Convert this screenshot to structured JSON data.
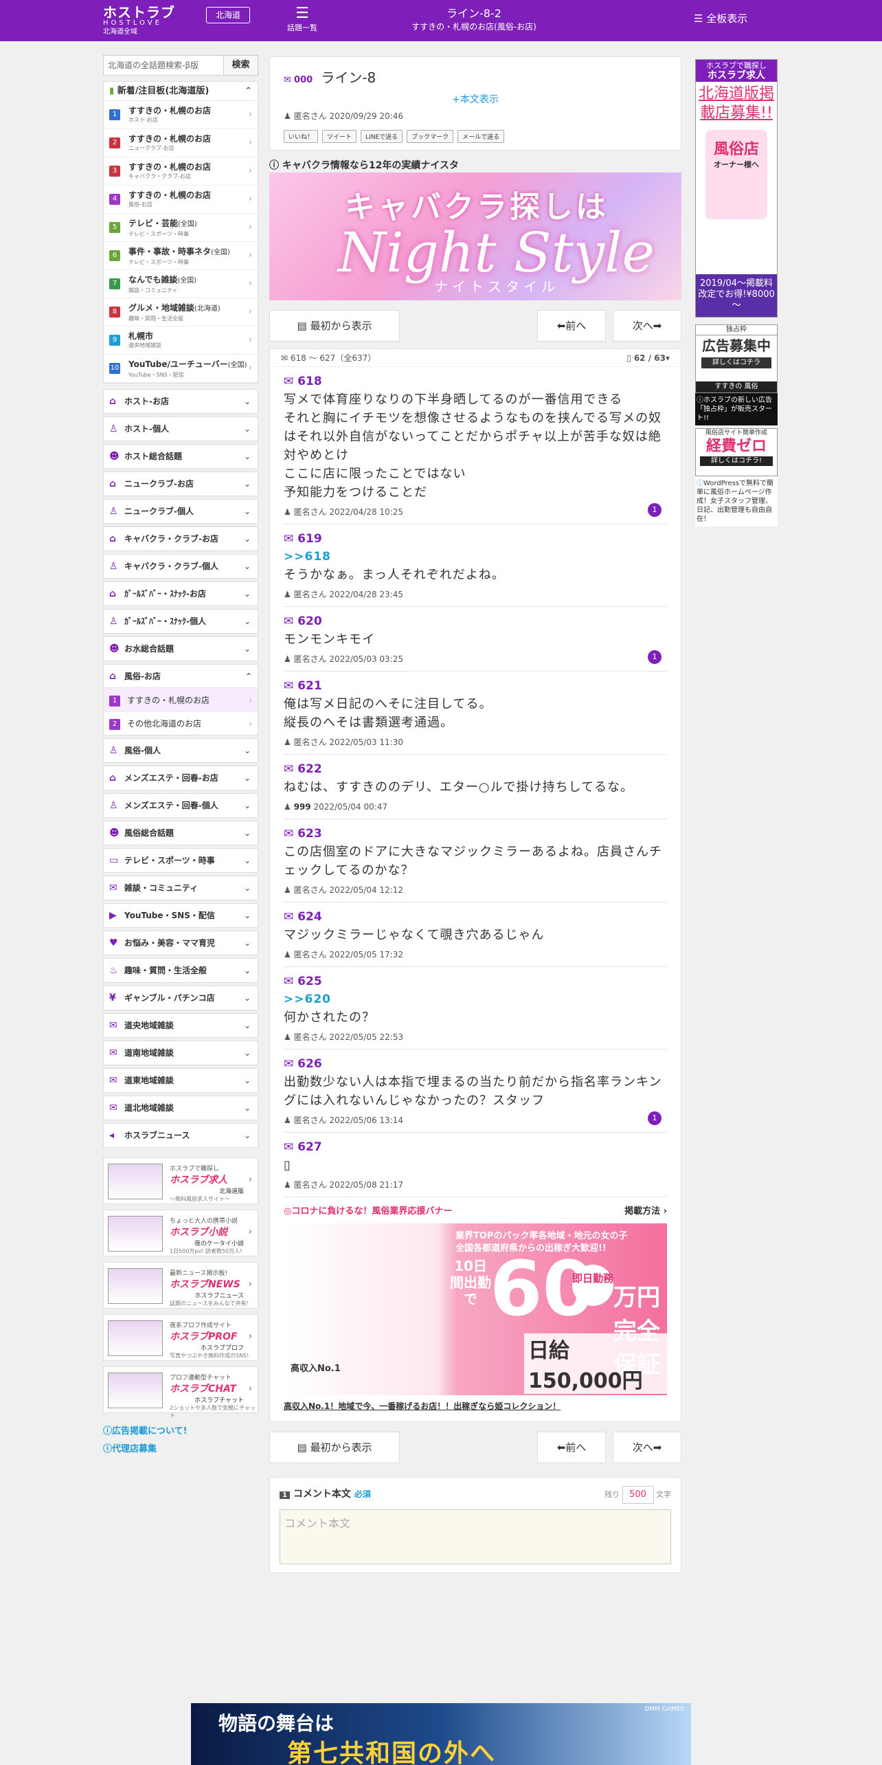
{
  "header": {
    "logo_main": "ホストラブ",
    "logo_sub": "HOSTLOVE",
    "logo_area": "北海道全域",
    "region_button": "北海道",
    "topics_label": "話題一覧",
    "title": "ライン-8-2",
    "subtitle": "すすきの・札幌のお店(風俗-お店)",
    "fullview_label": "全板表示"
  },
  "search": {
    "placeholder": "北海道の全話題検索-β版",
    "button": "検索"
  },
  "hot_board": {
    "title": "新着/注目板(北海道版)",
    "items": [
      {
        "no": "1",
        "name": "すすきの・札幌のお店",
        "sub": "ホスト-お店",
        "color": "#2f6fd0"
      },
      {
        "no": "2",
        "name": "すすきの・札幌のお店",
        "sub": "ニュークラブ-お店",
        "color": "#c8353f"
      },
      {
        "no": "3",
        "name": "すすきの・札幌のお店",
        "sub": "キャバクラ・クラブ-お店",
        "color": "#c8353f"
      },
      {
        "no": "4",
        "name": "すすきの・札幌のお店",
        "sub": "風俗-お店",
        "color": "#9b38c8"
      },
      {
        "no": "5",
        "name": "テレビ・芸能",
        "tag": "(全国)",
        "sub": "テレビ・スポーツ・時事",
        "color": "#6aa63a"
      },
      {
        "no": "6",
        "name": "事件・事故・時事ネタ",
        "tag": "(全国)",
        "sub": "テレビ・スポーツ・時事",
        "color": "#6aa63a"
      },
      {
        "no": "7",
        "name": "なんでも雑談",
        "tag": "(全国)",
        "sub": "雑談・コミュニティ",
        "color": "#3a9a4a"
      },
      {
        "no": "8",
        "name": "グルメ・地域雑談",
        "tag": "(北海道)",
        "sub": "趣味・質問・生活全般",
        "color": "#c8353f"
      },
      {
        "no": "9",
        "name": "札幌市",
        "tag": "",
        "sub": "道央地域雑談",
        "color": "#1d9cd6"
      },
      {
        "no": "10",
        "name": "YouTube/ユーチューバー",
        "tag": "(全国)",
        "sub": "YouTube・SNS・配信",
        "color": "#2f6fd0"
      }
    ]
  },
  "categories_a": [
    {
      "label": "ホスト-お店",
      "icon": "home-icon",
      "glyph": "⌂"
    },
    {
      "label": "ホスト-個人",
      "icon": "person-icon",
      "glyph": "♙"
    },
    {
      "label": "ホスト総合話題",
      "icon": "group-icon",
      "glyph": "☻"
    },
    {
      "label": "ニュークラブ-お店",
      "icon": "home-icon",
      "glyph": "⌂"
    },
    {
      "label": "ニュークラブ-個人",
      "icon": "person-icon",
      "glyph": "♙"
    },
    {
      "label": "キャバクラ・クラブ-お店",
      "icon": "home-icon",
      "glyph": "⌂"
    },
    {
      "label": "キャバクラ・クラブ-個人",
      "icon": "person-icon",
      "glyph": "♙"
    },
    {
      "label": "ｶﾞｰﾙｽﾞﾊﾞｰ・ｽﾅｯｸ-お店",
      "icon": "home-icon",
      "glyph": "⌂"
    },
    {
      "label": "ｶﾞｰﾙｽﾞﾊﾞｰ・ｽﾅｯｸ-個人",
      "icon": "person-icon",
      "glyph": "♙"
    },
    {
      "label": "お水総合話題",
      "icon": "group-icon",
      "glyph": "☻"
    }
  ],
  "fuzoku_open": {
    "label": "風俗-お店",
    "items": [
      {
        "no": "1",
        "name": "すすきの・札幌のお店"
      },
      {
        "no": "2",
        "name": "その他北海道のお店"
      }
    ]
  },
  "categories_b": [
    {
      "label": "風俗-個人",
      "icon": "person-icon",
      "glyph": "♙"
    },
    {
      "label": "メンズエステ・回春-お店",
      "icon": "home-icon",
      "glyph": "⌂"
    },
    {
      "label": "メンズエステ・回春-個人",
      "icon": "person-icon",
      "glyph": "♙"
    },
    {
      "label": "風俗総合話題",
      "icon": "group-icon",
      "glyph": "☻"
    },
    {
      "label": "テレビ・スポーツ・時事",
      "icon": "tv-icon",
      "glyph": "▭"
    },
    {
      "label": "雑談・コミュニティ",
      "icon": "chat-icon",
      "glyph": "✉"
    },
    {
      "label": "YouTube・SNS・配信",
      "icon": "youtube-icon",
      "glyph": "▶"
    },
    {
      "label": "お悩み・美容・ママ育児",
      "icon": "heart-icon",
      "glyph": "♥"
    },
    {
      "label": "趣味・質問・生活全般",
      "icon": "fork-icon",
      "glyph": "♨"
    },
    {
      "label": "ギャンブル・パチンコ店",
      "icon": "money-icon",
      "glyph": "¥"
    },
    {
      "label": "道央地域雑談",
      "icon": "comment-icon",
      "glyph": "✉"
    },
    {
      "label": "道南地域雑談",
      "icon": "comment-icon",
      "glyph": "✉"
    },
    {
      "label": "道東地域雑談",
      "icon": "comment-icon",
      "glyph": "✉"
    },
    {
      "label": "道北地域雑談",
      "icon": "comment-icon",
      "glyph": "✉"
    },
    {
      "label": "ホスラブニュース",
      "icon": "speaker-icon",
      "glyph": "◂"
    }
  ],
  "banners": [
    {
      "small": "ホスラブで職探し",
      "brand": "ホスラブ求人",
      "tag": "北海道版",
      "desc": "～無料風俗求人サイト～"
    },
    {
      "small": "ちょっと大人の携帯小説",
      "brand": "ホスラブ小説",
      "tag": "夜のケータイ小説",
      "desc": "1日500万pv! 読者数50万人!"
    },
    {
      "small": "最新ニュース掲示板!",
      "brand": "ホスラブNEWS",
      "tag": "ホスラブニュース",
      "desc": "話題のニュースをみんなで共有!"
    },
    {
      "small": "夜系プロフ作成サイト",
      "brand": "ホスラブPROF",
      "tag": "ホスラブプロフ",
      "desc": "写真やつぶやき無料作成のSNS!"
    },
    {
      "small": "プロフ連動型チャット",
      "brand": "ホスラブCHAT",
      "tag": "ホスラブチャット",
      "desc": "2ショットや多人数で気軽にチャット"
    }
  ],
  "side_links": [
    "広告掲載について!",
    "代理店募集"
  ],
  "thread": {
    "no": "000",
    "title": "ライン-8",
    "show_body": "+本文表示",
    "author": "匿名さん",
    "date": "2020/09/29 20:46",
    "share": [
      "いいね！",
      "ツイート",
      "LINEで送る",
      "ブックマーク",
      "メールで送る"
    ],
    "ad_header": "キャバクラ情報なら12年の実績ナイスタ",
    "ad_line1": "キャバクラ探しは",
    "ad_line2": "Night Style",
    "ad_line3": "ナイトスタイル"
  },
  "pager": {
    "first": "最初から表示",
    "prev": "前へ",
    "next": "次へ"
  },
  "posts_header": {
    "range": "618 ～ 627（全637）",
    "page": "62 / 63"
  },
  "posts": [
    {
      "no": "618",
      "anchor": "",
      "text": "写メで体育座りなりの下半身晒してるのが一番信用できる\nそれと胸にイチモツを想像させるようなものを挟んでる写メの奴はそれ以外自信がないってことだからポチャ以上が苦手な奴は絶対やめとけ\nここに店に限ったことではない\n予知能力をつけることだ",
      "author": "匿名さん",
      "date": "2022/04/28 10:25",
      "replies": "1"
    },
    {
      "no": "619",
      "anchor": ">>618",
      "text": "そうかなぁ。まっ人それぞれだよね。",
      "author": "匿名さん",
      "date": "2022/04/28 23:45",
      "replies": ""
    },
    {
      "no": "620",
      "anchor": "",
      "text": "モンモンキモイ",
      "author": "匿名さん",
      "date": "2022/05/03 03:25",
      "replies": "1"
    },
    {
      "no": "621",
      "anchor": "",
      "text": "俺は写メ日記のへそに注目してる。\n縦長のへそは書類選考通過。",
      "author": "匿名さん",
      "date": "2022/05/03 11:30",
      "replies": ""
    },
    {
      "no": "622",
      "anchor": "",
      "text": "ねむは、すすきののデリ、エター○ルで掛け持ちしてるな。",
      "author": "999",
      "date": "2022/05/04 00:47",
      "replies": ""
    },
    {
      "no": "623",
      "anchor": "",
      "text": "この店個室のドアに大きなマジックミラーあるよね。店員さんチェックしてるのかな？",
      "author": "匿名さん",
      "date": "2022/05/04 12:12",
      "replies": ""
    },
    {
      "no": "624",
      "anchor": "",
      "text": "マジックミラーじゃなくて覗き穴あるじゃん",
      "author": "匿名さん",
      "date": "2022/05/05 17:32",
      "replies": ""
    },
    {
      "no": "625",
      "anchor": ">>620",
      "text": "何かされたの？",
      "author": "匿名さん",
      "date": "2022/05/05 22:53",
      "replies": ""
    },
    {
      "no": "626",
      "anchor": "",
      "text": "出勤数少ない人は本指で埋まるの当たり前だから指名率ランキングには入れないんじゃなかったの？スタッフ",
      "author": "匿名さん",
      "date": "2022/05/06 13:14",
      "replies": "1"
    },
    {
      "no": "627",
      "anchor": "",
      "text": "▯",
      "author": "匿名さん",
      "date": "2022/05/08 21:17",
      "replies": ""
    }
  ],
  "support": {
    "title": "◎コロナに負けるな！風俗業界応援バナー",
    "method": "掲載方法",
    "copy1": "業界TOPのバック率各地域・地元の女の子",
    "copy2": "全国各都道府県からの出稼ぎ大歓迎!!",
    "days": "10日間出勤で",
    "amount": "60",
    "instant": "即日勤務",
    "unit": "万円",
    "guarantee": "完全保証",
    "daily": "日給150,000円",
    "highpay": "高収入No.1",
    "link": "高収入No.1！地域で今、一番稼げるお店！！出稼ぎなら姫コレクション！"
  },
  "form": {
    "label": "コメント本文",
    "required": "必須",
    "remain_label": "残り",
    "remain": "500",
    "unit": "文字",
    "placeholder": "コメント本文"
  },
  "right_ads": {
    "ad1_head": "ホスラブで職探し",
    "ad1_brand": "ホスラブ求人",
    "ad1_big": "北海道版掲載店募集!!",
    "ad1_mid": "風俗店",
    "ad1_owner": "オーナー様へ",
    "ad1_foot": "2019/04～掲載料改定でお得!¥8000～",
    "ad2_head": "独占枠",
    "ad2_main": "広告募集中",
    "ad2_cta": "詳しくはコチラ",
    "ad2_area": "すすきの 風俗",
    "ad2_note": "ホスラブの新しい広告「独占枠」が販売スタート!!",
    "ad3_head": "風俗店サイト簡単作成",
    "ad3_main": "経費ゼロ",
    "ad3_cta": "詳しくはコチラ!",
    "ad3_note": "WordPressで無料で簡単に風俗ホームページ作成！女子スタッフ管理、日記、出勤管理も自由自在！"
  },
  "bottom_ad": {
    "line1": "物語の舞台は",
    "line2": "第七共和国の外へ",
    "brand": "DMM GAMES"
  }
}
